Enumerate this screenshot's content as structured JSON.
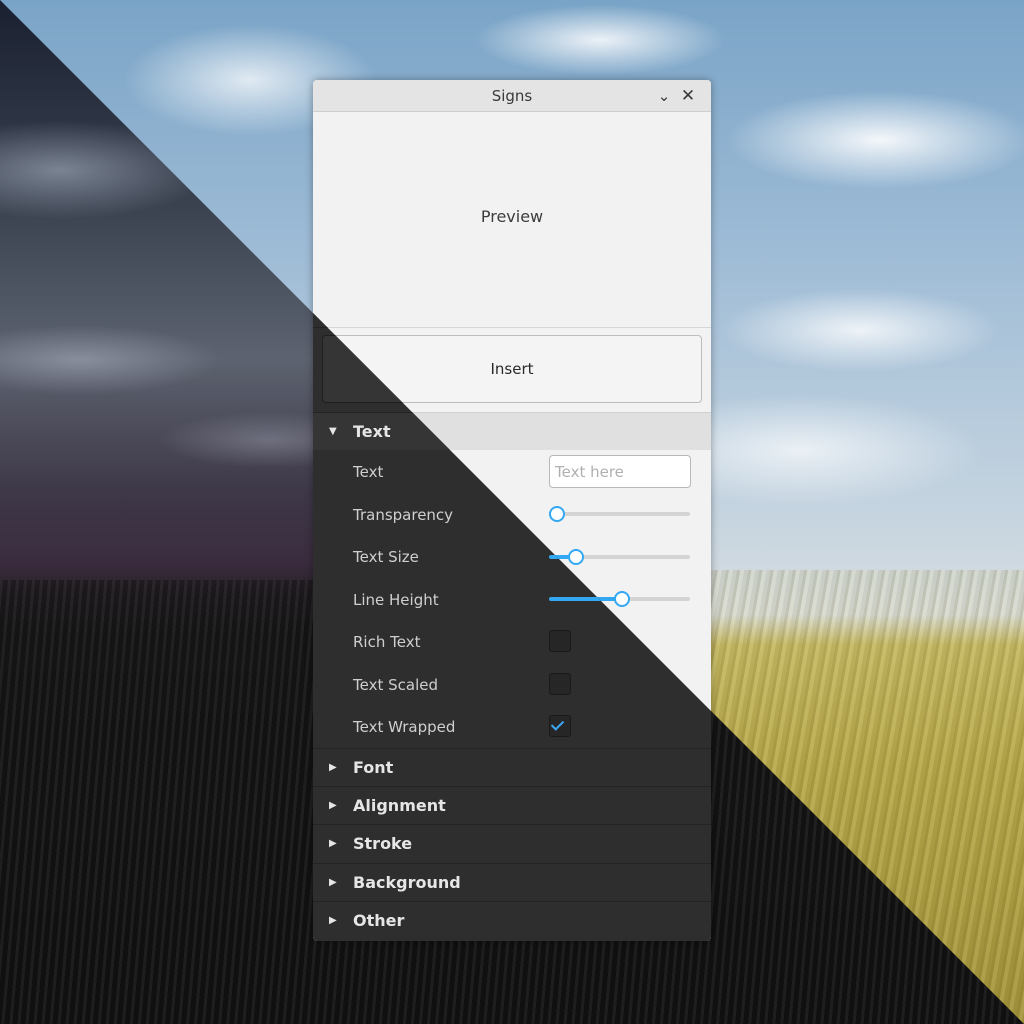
{
  "window": {
    "title": "Signs",
    "collapse_icon": "chevron-down-icon",
    "close_icon": "close-icon"
  },
  "preview": {
    "label": "Preview"
  },
  "insert_button": {
    "label": "Insert"
  },
  "sections": {
    "text": {
      "label": "Text",
      "expanded": true
    },
    "font": {
      "label": "Font",
      "expanded": false
    },
    "alignment": {
      "label": "Alignment",
      "expanded": false
    },
    "stroke": {
      "label": "Stroke",
      "expanded": false
    },
    "background": {
      "label": "Background",
      "expanded": false
    },
    "other": {
      "label": "Other",
      "expanded": false
    }
  },
  "text_properties": {
    "text": {
      "label": "Text",
      "value": "",
      "placeholder": "Text here"
    },
    "transparency": {
      "label": "Transparency",
      "value": 0.0
    },
    "text_size": {
      "label": "Text Size",
      "value": 0.15
    },
    "line_height": {
      "label": "Line Height",
      "value": 0.5
    },
    "rich_text": {
      "label": "Rich Text",
      "checked": false
    },
    "text_scaled": {
      "label": "Text Scaled",
      "checked": false
    },
    "text_wrapped": {
      "label": "Text Wrapped",
      "checked": true
    }
  },
  "colors": {
    "accent": "#33a8f2",
    "light_panel": "#f2f2f2",
    "dark_panel": "#2e2e2e"
  }
}
